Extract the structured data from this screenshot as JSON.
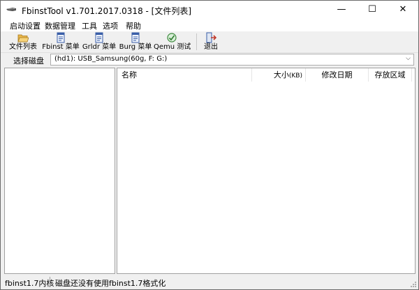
{
  "window": {
    "title": "FbinstTool v1.701.2017.0318 - [文件列表]",
    "minimize": "—",
    "maximize": "☐",
    "close": "✕"
  },
  "menu": [
    "启动设置",
    "数据管理",
    "工具",
    "选项",
    "帮助"
  ],
  "toolbar": {
    "file_list": "文件列表",
    "fbinst_menu": "Fbinst 菜单",
    "grldr_menu": "Grldr 菜单",
    "burg_menu": "Burg 菜单",
    "qemu_test": "Qemu 测试",
    "exit": "退出"
  },
  "disk": {
    "label": "选择磁盘",
    "value": "(hd1): USB_Samsung(60g, F: G:)"
  },
  "file_table": {
    "col_name": "名称",
    "col_size": "大小",
    "col_size_unit": "(KB)",
    "col_date": "修改日期",
    "col_area": "存放区域"
  },
  "status": {
    "kernel": "fbinst1.7内核",
    "message": "磁盘还没有使用fbinst1.7格式化"
  }
}
